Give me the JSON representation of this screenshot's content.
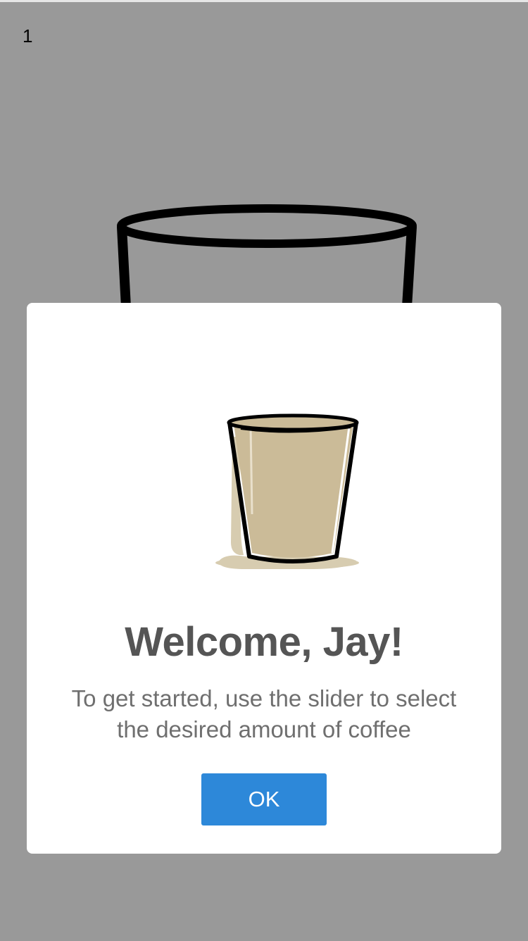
{
  "app": {
    "counter": "1"
  },
  "dialog": {
    "illustration_icon": "spilled-coffee-cup-icon",
    "title": "Welcome, Jay!",
    "message": "To get started, use the slider to select the desired amount of coffee",
    "ok_label": "OK"
  },
  "colors": {
    "accent": "#2d88d9",
    "coffee": "#cbbb98",
    "overlay": "rgba(0,0,0,0.40)",
    "title_text": "#555555"
  }
}
